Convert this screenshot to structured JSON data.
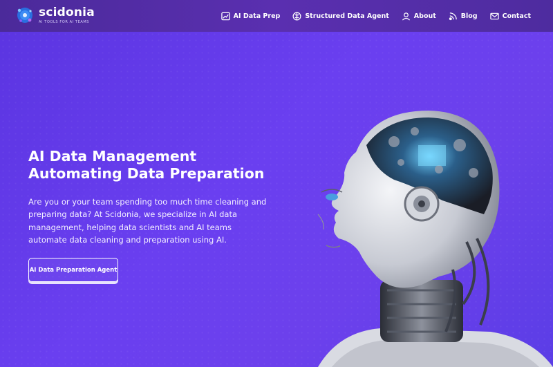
{
  "header": {
    "brand": "scidonia",
    "tagline": "AI TOOLS FOR AI TEAMS",
    "nav": [
      {
        "label": "AI Data Prep",
        "icon": "chart-icon"
      },
      {
        "label": "Structured Data Agent",
        "icon": "brain-icon"
      },
      {
        "label": "About",
        "icon": "user-icon"
      },
      {
        "label": "Blog",
        "icon": "blog-icon"
      },
      {
        "label": "Contact",
        "icon": "mail-icon"
      }
    ]
  },
  "hero": {
    "title_line1": "AI Data Management",
    "title_line2": "Automating Data Preparation",
    "description": "Are you or your team spending too much time cleaning and preparing data? At Scidonia, we specialize in AI data management, helping data scientists and AI teams automate data cleaning and preparation using AI.",
    "cta_label": "AI Data Preparation Agent"
  },
  "colors": {
    "background": "#6a3ff0",
    "header": "#5a2fb0",
    "accent": "#2a9df4"
  }
}
